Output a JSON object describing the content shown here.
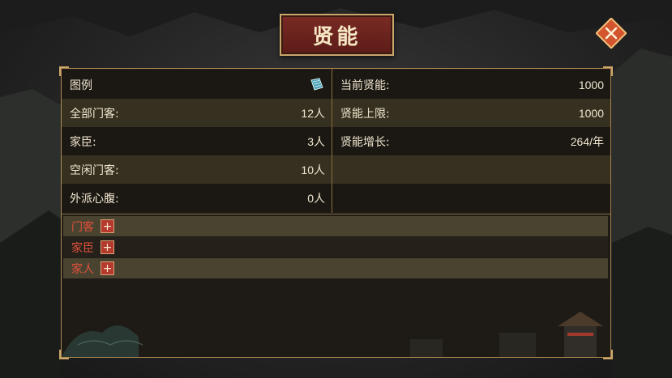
{
  "title": "贤能",
  "close_icon": "close-x-icon",
  "legend": {
    "label": "图例",
    "icon": "book-scroll-icon"
  },
  "left_stats": [
    {
      "label": "全部门客:",
      "value": "12人"
    },
    {
      "label": "家臣:",
      "value": "3人"
    },
    {
      "label": "空闲门客:",
      "value": "10人"
    },
    {
      "label": "外派心腹:",
      "value": "0人"
    }
  ],
  "right_stats": [
    {
      "label": "当前贤能:",
      "value": "1000"
    },
    {
      "label": "贤能上限:",
      "value": "1000"
    },
    {
      "label": "贤能增长:",
      "value": "264/年"
    }
  ],
  "categories": [
    {
      "label": "门客",
      "button": "+"
    },
    {
      "label": "家臣",
      "button": "+"
    },
    {
      "label": "家人",
      "button": "+"
    }
  ],
  "colors": {
    "accent_red": "#b33a2c",
    "gold_border": "#c9a66a",
    "category_text": "#e0503a"
  }
}
